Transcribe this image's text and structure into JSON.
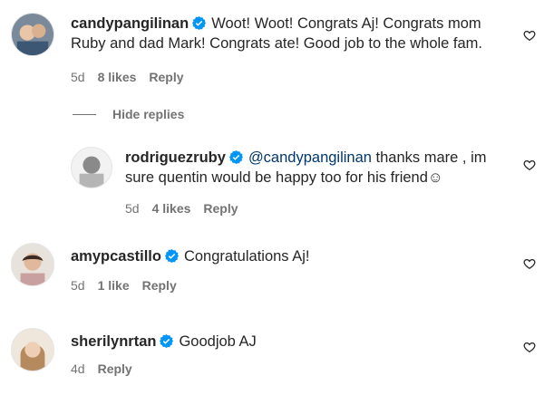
{
  "comments": [
    {
      "username": "candypangilinan",
      "text_lines": [
        "Woot! Woot! Congrats Aj! Congrats mom",
        "Ruby and dad Mark! Congrats ate! Good job to the whole fam."
      ],
      "time": "5d",
      "likes": "8 likes",
      "reply": "Reply"
    },
    {
      "username": "rodriguezruby",
      "mention": "@candypangilinan",
      "text_lines": [
        " thanks mare , im",
        "sure quentin would be happy too for his friend☺"
      ],
      "time": "5d",
      "likes": "4 likes",
      "reply": "Reply"
    },
    {
      "username": "amypcastillo",
      "text_lines": [
        "Congratulations Aj!"
      ],
      "time": "5d",
      "likes": "1 like",
      "reply": "Reply"
    },
    {
      "username": "sherilynrtan",
      "text_lines": [
        "Goodjob AJ"
      ],
      "time": "4d",
      "reply": "Reply"
    }
  ],
  "hide_replies_label": "Hide replies",
  "colors": {
    "verified": "#0095f6",
    "meta": "#737373",
    "mention": "#00376b"
  }
}
